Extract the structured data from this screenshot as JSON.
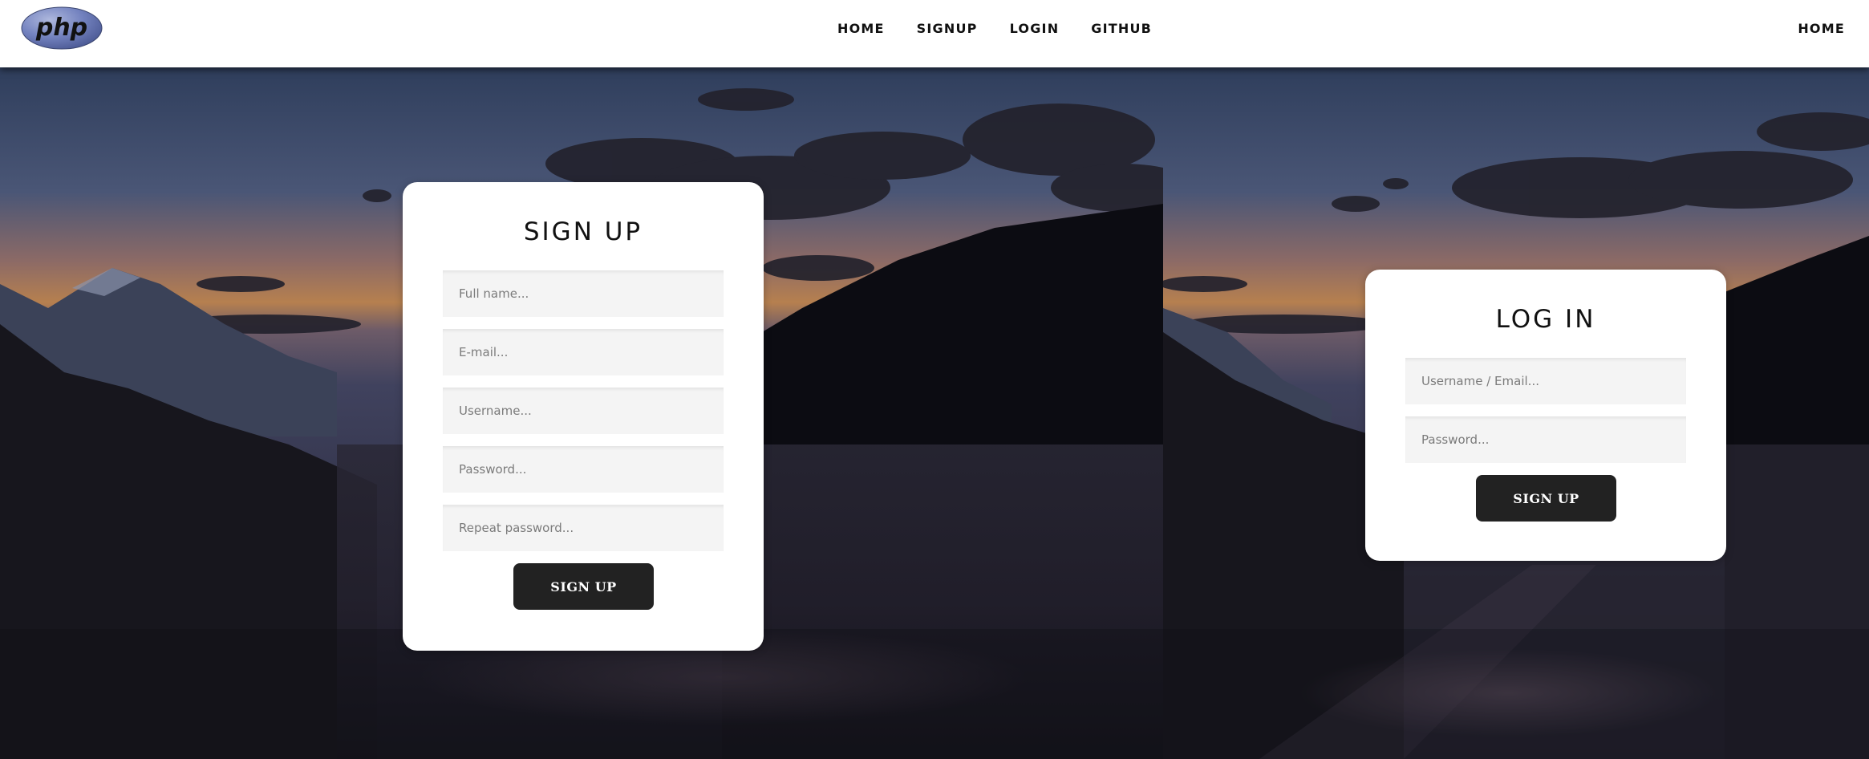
{
  "header": {
    "logo_text": "php",
    "nav": [
      "HOME",
      "SIGNUP",
      "LOGIN",
      "GITHUB"
    ],
    "nav_right": "HOME"
  },
  "signup": {
    "title": "SIGN UP",
    "fields": [
      {
        "placeholder": "Full name..."
      },
      {
        "placeholder": "E-mail..."
      },
      {
        "placeholder": "Username..."
      },
      {
        "placeholder": "Password..."
      },
      {
        "placeholder": "Repeat password..."
      }
    ],
    "button": "SIGN UP"
  },
  "login": {
    "title": "LOG IN",
    "fields": [
      {
        "placeholder": "Username / Email..."
      },
      {
        "placeholder": "Password..."
      }
    ],
    "button": "SIGN UP"
  },
  "colors": {
    "header_bg": "#ffffff",
    "button_bg": "#222222",
    "field_bg": "#f4f4f4",
    "php_logo": "#6c7eb7"
  }
}
